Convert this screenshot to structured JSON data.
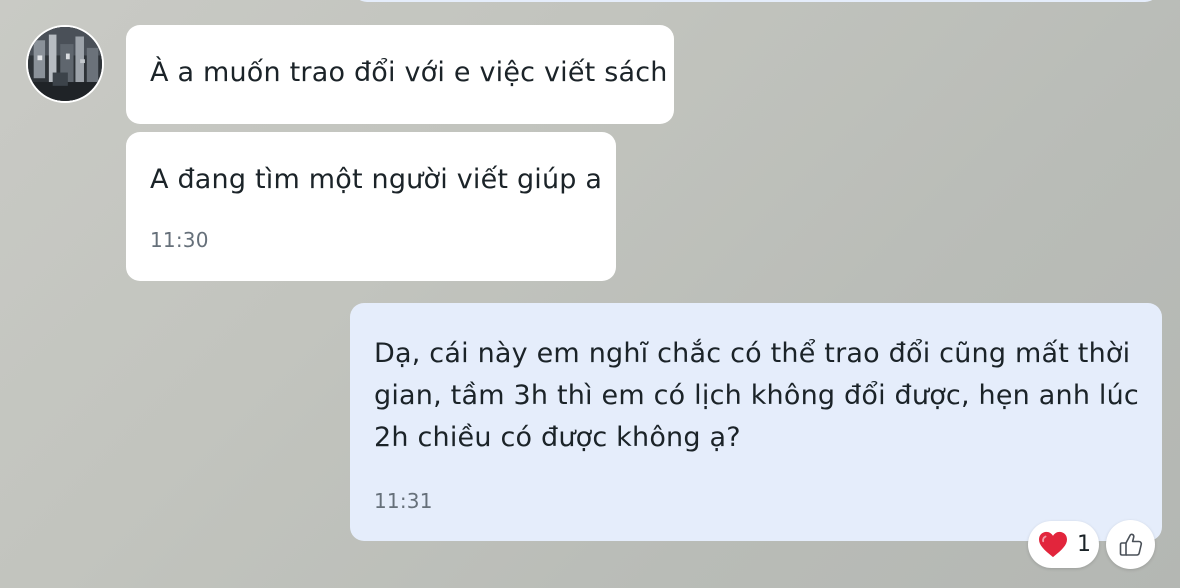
{
  "messages": [
    {
      "direction": "incoming",
      "text": "À a muốn trao đổi với e việc viết sách"
    },
    {
      "direction": "incoming",
      "text": "A đang tìm một người viết giúp a",
      "time": "11:30"
    },
    {
      "direction": "outgoing",
      "text": "Dạ, cái này em nghĩ chắc có thể trao đổi cũng mất thời gian, tầm 3h thì em có lịch không đổi được, hẹn anh lúc 2h chiều có được không ạ?",
      "time": "11:31",
      "reaction": {
        "icon": "heart-icon",
        "count": "1"
      }
    }
  ],
  "icons": {
    "avatar": "avatar",
    "heart": "heart-icon",
    "like": "thumbs-up-icon"
  },
  "colors": {
    "incoming_bubble": "#ffffff",
    "outgoing_bubble": "#e5edfb",
    "heart": "#e2253c"
  }
}
